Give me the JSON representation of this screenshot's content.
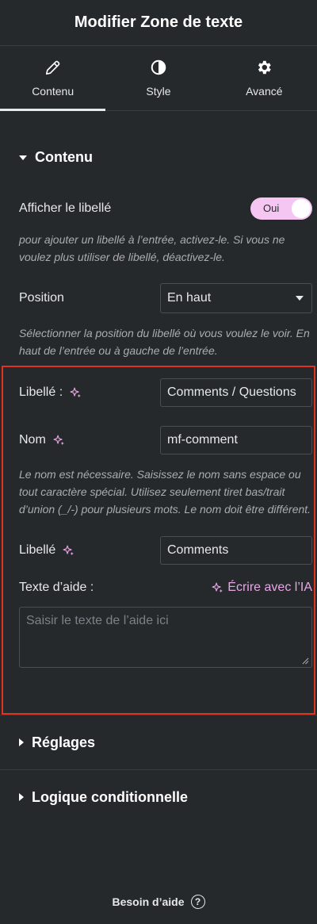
{
  "header": {
    "title": "Modifier Zone de texte"
  },
  "tabs": [
    {
      "label": "Contenu",
      "icon": "pencil-icon",
      "active": true
    },
    {
      "label": "Style",
      "icon": "half-circle-icon",
      "active": false
    },
    {
      "label": "Avancé",
      "icon": "gear-icon",
      "active": false
    }
  ],
  "content_section": {
    "title": "Contenu",
    "show_label": {
      "label": "Afficher le libellé",
      "toggle_text": "Oui",
      "value": true
    },
    "show_label_desc": "pour ajouter un libellé à l’entrée, activez-le. Si vous ne voulez plus utiliser de libellé, déactivez-le.",
    "position": {
      "label": "Position",
      "value": "En haut"
    },
    "position_desc": "Sélectionner la position du libellé où vous voulez le voir. En haut de l’entrée ou à gauche de l’entrée.",
    "label_field": {
      "label": "Libellé :",
      "value": "Comments / Questions"
    },
    "name_field": {
      "label": "Nom",
      "value": "mf-comment"
    },
    "name_desc": "Le nom est nécessaire. Saisissez le nom sans espace ou tout caractère spécial. Utilisez seulement tiret bas/trait d’union (_/-) pour plusieurs mots. Le nom doit être différent.",
    "label2_field": {
      "label": "Libellé",
      "value": "Comments"
    },
    "help_text": {
      "label": "Texte d’aide :",
      "ai_link": "Écrire avec l’IA",
      "placeholder": "Saisir le texte de l’aide ici"
    }
  },
  "sections": [
    {
      "title": "Réglages"
    },
    {
      "title": "Logique conditionnelle"
    }
  ],
  "footer": {
    "text": "Besoin d’aide",
    "icon_glyph": "?"
  },
  "colors": {
    "background": "#26292c",
    "accent_pink": "#e8a6e6",
    "toggle_bg": "#f5c6f1",
    "highlight": "#e2311d"
  }
}
